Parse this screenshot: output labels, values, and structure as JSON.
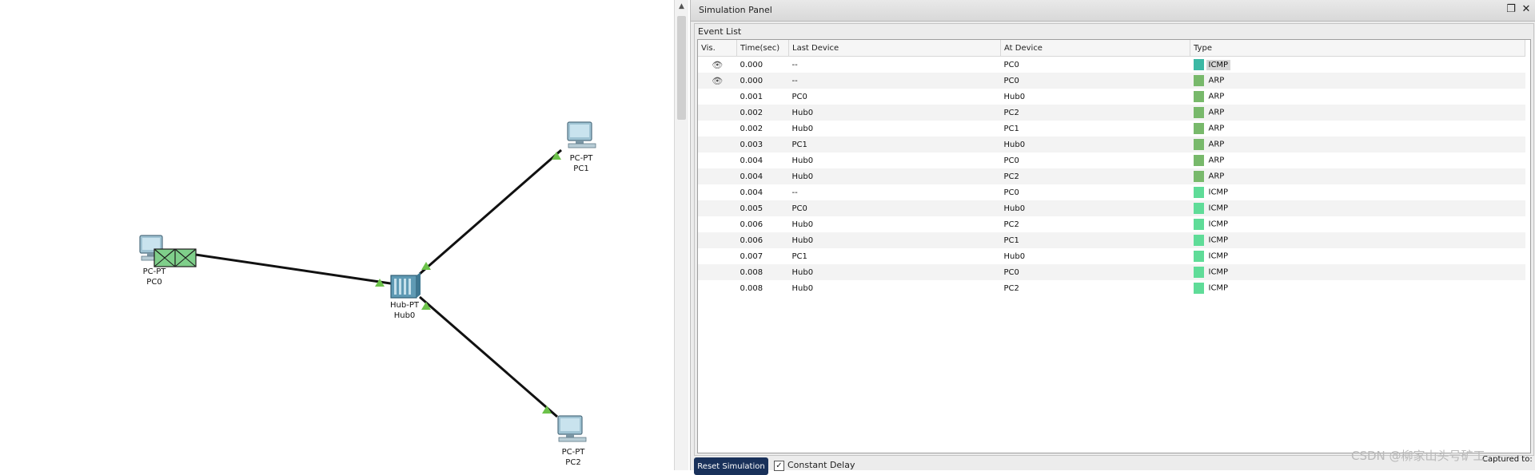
{
  "workspace": {
    "devices": [
      {
        "id": "pc0",
        "model": "PC-PT",
        "name": "PC0",
        "icon": "pc-icon"
      },
      {
        "id": "hub0",
        "model": "Hub-PT",
        "name": "Hub0",
        "icon": "hub-icon"
      },
      {
        "id": "pc1",
        "model": "PC-PT",
        "name": "PC1",
        "icon": "pc-icon"
      },
      {
        "id": "pc2",
        "model": "PC-PT",
        "name": "PC2",
        "icon": "pc-icon"
      }
    ],
    "link_status_color": "#6cc24a",
    "packet_color": "#7fcf8a"
  },
  "sim_panel": {
    "title": "Simulation Panel",
    "event_list_label": "Event List",
    "columns": [
      "Vis.",
      "Time(sec)",
      "Last Device",
      "At Device",
      "Type"
    ],
    "events": [
      {
        "vis": true,
        "time": "0.000",
        "last": "--",
        "at": "PC0",
        "type": "ICMP",
        "color": "#3bb8a4",
        "highlight": true
      },
      {
        "vis": true,
        "time": "0.000",
        "last": "--",
        "at": "PC0",
        "type": "ARP",
        "color": "#78b96b"
      },
      {
        "vis": false,
        "time": "0.001",
        "last": "PC0",
        "at": "Hub0",
        "type": "ARP",
        "color": "#78b96b"
      },
      {
        "vis": false,
        "time": "0.002",
        "last": "Hub0",
        "at": "PC2",
        "type": "ARP",
        "color": "#78b96b"
      },
      {
        "vis": false,
        "time": "0.002",
        "last": "Hub0",
        "at": "PC1",
        "type": "ARP",
        "color": "#78b96b"
      },
      {
        "vis": false,
        "time": "0.003",
        "last": "PC1",
        "at": "Hub0",
        "type": "ARP",
        "color": "#78b96b"
      },
      {
        "vis": false,
        "time": "0.004",
        "last": "Hub0",
        "at": "PC0",
        "type": "ARP",
        "color": "#78b96b"
      },
      {
        "vis": false,
        "time": "0.004",
        "last": "Hub0",
        "at": "PC2",
        "type": "ARP",
        "color": "#78b96b"
      },
      {
        "vis": false,
        "time": "0.004",
        "last": "--",
        "at": "PC0",
        "type": "ICMP",
        "color": "#5fdc98"
      },
      {
        "vis": false,
        "time": "0.005",
        "last": "PC0",
        "at": "Hub0",
        "type": "ICMP",
        "color": "#5fdc98"
      },
      {
        "vis": false,
        "time": "0.006",
        "last": "Hub0",
        "at": "PC2",
        "type": "ICMP",
        "color": "#5fdc98"
      },
      {
        "vis": false,
        "time": "0.006",
        "last": "Hub0",
        "at": "PC1",
        "type": "ICMP",
        "color": "#5fdc98"
      },
      {
        "vis": false,
        "time": "0.007",
        "last": "PC1",
        "at": "Hub0",
        "type": "ICMP",
        "color": "#5fdc98"
      },
      {
        "vis": false,
        "time": "0.008",
        "last": "Hub0",
        "at": "PC0",
        "type": "ICMP",
        "color": "#5fdc98"
      },
      {
        "vis": false,
        "time": "0.008",
        "last": "Hub0",
        "at": "PC2",
        "type": "ICMP",
        "color": "#5fdc98"
      }
    ],
    "reset_label": "Reset Simulation",
    "constant_delay_label": "Constant Delay",
    "captured_label": "Captured to:"
  },
  "watermark": "CSDN @柳家山头号矿工"
}
